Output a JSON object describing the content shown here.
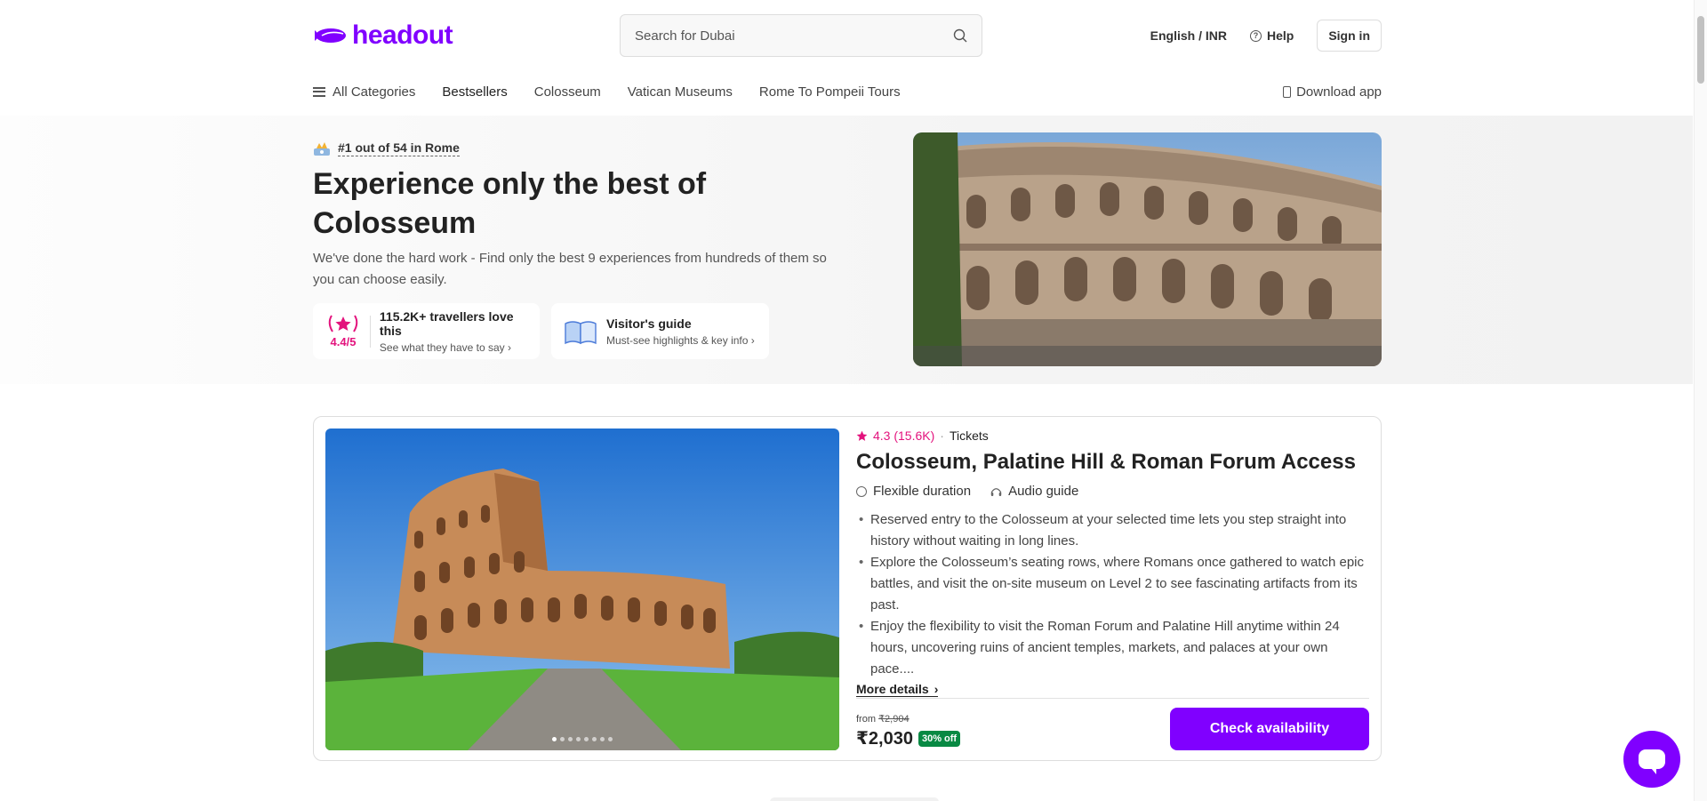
{
  "header": {
    "logo": "headout",
    "search_placeholder": "Search for Dubai",
    "language": "English / INR",
    "help": "Help",
    "sign_in": "Sign in"
  },
  "nav": {
    "all_categories": "All Categories",
    "items": [
      "Bestsellers",
      "Colosseum",
      "Vatican Museums",
      "Rome To Pompeii Tours"
    ],
    "download_app": "Download app"
  },
  "hero": {
    "rank": "#1 out of 54 in Rome",
    "title": "Experience only the best of Colosseum",
    "subtitle": "We've done the hard work - Find only the best 9 experiences from hundreds of them so you can choose easily.",
    "reviews": {
      "rating": "4.4/5",
      "label": "115.2K+ travellers love this",
      "sub": "See what they have to say"
    },
    "guide": {
      "label": "Visitor's guide",
      "sub": "Must-see highlights & key info"
    }
  },
  "product": {
    "rating": "4.3",
    "reviews_count": "(15.6K)",
    "category": "Tickets",
    "title": "Colosseum, Palatine Hill & Roman Forum Access",
    "duration": "Flexible duration",
    "audio": "Audio guide",
    "bullets": [
      "Reserved entry to the Colosseum at your selected time lets you step straight into history without waiting in long lines.",
      "Explore the Colosseum’s seating rows, where Romans once gathered to watch epic battles, and visit the on-site museum on Level 2 to see fascinating artifacts from its past.",
      "Enjoy the flexibility to visit the Roman Forum and Palatine Hill anytime within 24 hours, uncovering ruins of ancient temples, markets, and palaces at your own pace...."
    ],
    "more_details": "More details",
    "from_label": "from",
    "original_price": "₹2,904",
    "price": "₹2,030",
    "discount": "30% off",
    "cta": "Check availability",
    "image_count": 8,
    "active_image": 1
  },
  "colors": {
    "brand": "#8000ff",
    "rating_pink": "#e3137d",
    "discount_green": "#088943"
  }
}
